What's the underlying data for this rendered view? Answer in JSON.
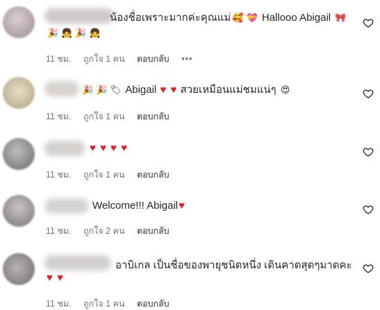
{
  "icons": {
    "like": "heart-outline-icon",
    "more": "more-dots-icon"
  },
  "colors": {
    "text": "#262626",
    "meta": "#737373",
    "heart": "#ed1c24"
  },
  "comments": [
    {
      "line1": "น้องชื่อเพราะมากค่ะคุณแม่",
      "line1_after": "Hallooo Abigail",
      "line2": "",
      "time": "11 ชม.",
      "likes": "ถูกใจ 1 คน",
      "reply": "ตอบกลับ",
      "more": "•••"
    },
    {
      "line1": "Abigail",
      "line1_after": "สวยเหมือนแม่ชมแน่ๆ",
      "time": "11 ชม.",
      "likes": "ถูกใจ 1 คน",
      "reply": "ตอบกลับ"
    },
    {
      "line1": "",
      "time": "11 ชม.",
      "likes": "ถูกใจ 1 คน",
      "reply": "ตอบกลับ"
    },
    {
      "line1": "Welcome!!! Abigail",
      "time": "11 ชม.",
      "likes": "ถูกใจ 2 คน",
      "reply": "ตอบกลับ"
    },
    {
      "line1": "อาบิเกล เป็นชื่อของพายุชนิดหนึ่ง เดินคาดสุดๆมาดคะ",
      "time": "11 ชม.",
      "likes": "ถูกใจ 1 คน",
      "reply": "ตอบกลับ"
    }
  ]
}
